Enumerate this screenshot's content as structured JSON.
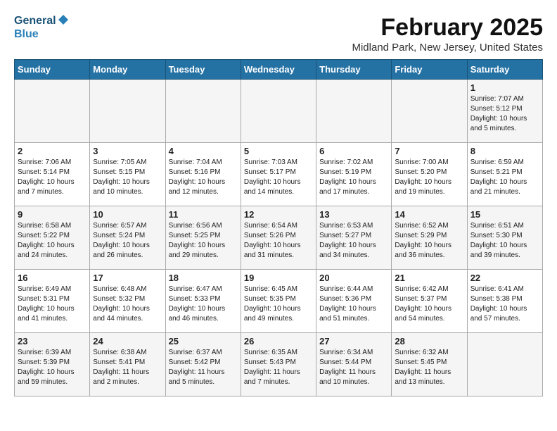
{
  "logo": {
    "line1": "General",
    "line2": "Blue"
  },
  "calendar": {
    "title": "February 2025",
    "subtitle": "Midland Park, New Jersey, United States"
  },
  "weekdays": [
    "Sunday",
    "Monday",
    "Tuesday",
    "Wednesday",
    "Thursday",
    "Friday",
    "Saturday"
  ],
  "weeks": [
    [
      {
        "day": "",
        "info": ""
      },
      {
        "day": "",
        "info": ""
      },
      {
        "day": "",
        "info": ""
      },
      {
        "day": "",
        "info": ""
      },
      {
        "day": "",
        "info": ""
      },
      {
        "day": "",
        "info": ""
      },
      {
        "day": "1",
        "info": "Sunrise: 7:07 AM\nSunset: 5:12 PM\nDaylight: 10 hours\nand 5 minutes."
      }
    ],
    [
      {
        "day": "2",
        "info": "Sunrise: 7:06 AM\nSunset: 5:14 PM\nDaylight: 10 hours\nand 7 minutes."
      },
      {
        "day": "3",
        "info": "Sunrise: 7:05 AM\nSunset: 5:15 PM\nDaylight: 10 hours\nand 10 minutes."
      },
      {
        "day": "4",
        "info": "Sunrise: 7:04 AM\nSunset: 5:16 PM\nDaylight: 10 hours\nand 12 minutes."
      },
      {
        "day": "5",
        "info": "Sunrise: 7:03 AM\nSunset: 5:17 PM\nDaylight: 10 hours\nand 14 minutes."
      },
      {
        "day": "6",
        "info": "Sunrise: 7:02 AM\nSunset: 5:19 PM\nDaylight: 10 hours\nand 17 minutes."
      },
      {
        "day": "7",
        "info": "Sunrise: 7:00 AM\nSunset: 5:20 PM\nDaylight: 10 hours\nand 19 minutes."
      },
      {
        "day": "8",
        "info": "Sunrise: 6:59 AM\nSunset: 5:21 PM\nDaylight: 10 hours\nand 21 minutes."
      }
    ],
    [
      {
        "day": "9",
        "info": "Sunrise: 6:58 AM\nSunset: 5:22 PM\nDaylight: 10 hours\nand 24 minutes."
      },
      {
        "day": "10",
        "info": "Sunrise: 6:57 AM\nSunset: 5:24 PM\nDaylight: 10 hours\nand 26 minutes."
      },
      {
        "day": "11",
        "info": "Sunrise: 6:56 AM\nSunset: 5:25 PM\nDaylight: 10 hours\nand 29 minutes."
      },
      {
        "day": "12",
        "info": "Sunrise: 6:54 AM\nSunset: 5:26 PM\nDaylight: 10 hours\nand 31 minutes."
      },
      {
        "day": "13",
        "info": "Sunrise: 6:53 AM\nSunset: 5:27 PM\nDaylight: 10 hours\nand 34 minutes."
      },
      {
        "day": "14",
        "info": "Sunrise: 6:52 AM\nSunset: 5:29 PM\nDaylight: 10 hours\nand 36 minutes."
      },
      {
        "day": "15",
        "info": "Sunrise: 6:51 AM\nSunset: 5:30 PM\nDaylight: 10 hours\nand 39 minutes."
      }
    ],
    [
      {
        "day": "16",
        "info": "Sunrise: 6:49 AM\nSunset: 5:31 PM\nDaylight: 10 hours\nand 41 minutes."
      },
      {
        "day": "17",
        "info": "Sunrise: 6:48 AM\nSunset: 5:32 PM\nDaylight: 10 hours\nand 44 minutes."
      },
      {
        "day": "18",
        "info": "Sunrise: 6:47 AM\nSunset: 5:33 PM\nDaylight: 10 hours\nand 46 minutes."
      },
      {
        "day": "19",
        "info": "Sunrise: 6:45 AM\nSunset: 5:35 PM\nDaylight: 10 hours\nand 49 minutes."
      },
      {
        "day": "20",
        "info": "Sunrise: 6:44 AM\nSunset: 5:36 PM\nDaylight: 10 hours\nand 51 minutes."
      },
      {
        "day": "21",
        "info": "Sunrise: 6:42 AM\nSunset: 5:37 PM\nDaylight: 10 hours\nand 54 minutes."
      },
      {
        "day": "22",
        "info": "Sunrise: 6:41 AM\nSunset: 5:38 PM\nDaylight: 10 hours\nand 57 minutes."
      }
    ],
    [
      {
        "day": "23",
        "info": "Sunrise: 6:39 AM\nSunset: 5:39 PM\nDaylight: 10 hours\nand 59 minutes."
      },
      {
        "day": "24",
        "info": "Sunrise: 6:38 AM\nSunset: 5:41 PM\nDaylight: 11 hours\nand 2 minutes."
      },
      {
        "day": "25",
        "info": "Sunrise: 6:37 AM\nSunset: 5:42 PM\nDaylight: 11 hours\nand 5 minutes."
      },
      {
        "day": "26",
        "info": "Sunrise: 6:35 AM\nSunset: 5:43 PM\nDaylight: 11 hours\nand 7 minutes."
      },
      {
        "day": "27",
        "info": "Sunrise: 6:34 AM\nSunset: 5:44 PM\nDaylight: 11 hours\nand 10 minutes."
      },
      {
        "day": "28",
        "info": "Sunrise: 6:32 AM\nSunset: 5:45 PM\nDaylight: 11 hours\nand 13 minutes."
      },
      {
        "day": "",
        "info": ""
      }
    ]
  ]
}
